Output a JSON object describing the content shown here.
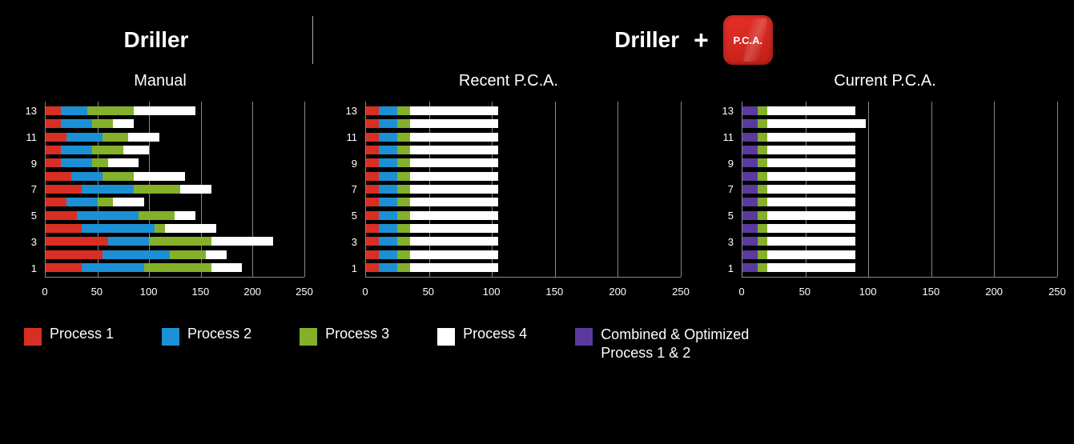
{
  "header": {
    "left_title": "Driller",
    "right_title": "Driller",
    "plus": "+",
    "badge": "P.C.A."
  },
  "legend": {
    "p1": "Process 1",
    "p2": "Process 2",
    "p3": "Process 3",
    "p4": "Process 4",
    "pc": "Combined & Optimized Process 1 & 2"
  },
  "colors": {
    "p1": "#d92e23",
    "p2": "#1c90d4",
    "p3": "#85b02a",
    "p4": "#ffffff",
    "pc": "#5a3a9e"
  },
  "chart_data": [
    {
      "id": "manual",
      "title": "Manual",
      "type": "bar",
      "orientation": "horizontal",
      "stacked": true,
      "xlim": [
        0,
        250
      ],
      "xticks": [
        0,
        50,
        100,
        150,
        200,
        250
      ],
      "yticks": [
        1,
        3,
        5,
        7,
        9,
        11,
        13
      ],
      "categories": [
        1,
        2,
        3,
        4,
        5,
        6,
        7,
        8,
        9,
        10,
        11,
        12,
        13
      ],
      "series": [
        {
          "name": "Process 1",
          "key": "p1",
          "values": [
            35,
            55,
            60,
            35,
            30,
            20,
            35,
            25,
            15,
            15,
            20,
            15,
            15
          ]
        },
        {
          "name": "Process 2",
          "key": "p2",
          "values": [
            60,
            65,
            40,
            70,
            60,
            30,
            50,
            30,
            30,
            30,
            35,
            30,
            25
          ]
        },
        {
          "name": "Process 3",
          "key": "p3",
          "values": [
            65,
            35,
            60,
            10,
            35,
            15,
            45,
            30,
            15,
            30,
            25,
            20,
            45
          ]
        },
        {
          "name": "Process 4",
          "key": "p4",
          "values": [
            30,
            20,
            60,
            50,
            20,
            30,
            30,
            50,
            30,
            25,
            30,
            20,
            60
          ]
        }
      ]
    },
    {
      "id": "recent",
      "title": "Recent P.C.A.",
      "type": "bar",
      "orientation": "horizontal",
      "stacked": true,
      "xlim": [
        0,
        250
      ],
      "xticks": [
        0,
        50,
        100,
        150,
        200,
        250
      ],
      "yticks": [
        1,
        3,
        5,
        7,
        9,
        11,
        13
      ],
      "categories": [
        1,
        2,
        3,
        4,
        5,
        6,
        7,
        8,
        9,
        10,
        11,
        12,
        13
      ],
      "series": [
        {
          "name": "Process 1",
          "key": "p1",
          "values": [
            10,
            10,
            10,
            10,
            10,
            10,
            10,
            10,
            10,
            10,
            10,
            10,
            10
          ]
        },
        {
          "name": "Process 2",
          "key": "p2",
          "values": [
            15,
            15,
            15,
            15,
            15,
            15,
            15,
            15,
            15,
            15,
            15,
            15,
            15
          ]
        },
        {
          "name": "Process 3",
          "key": "p3",
          "values": [
            10,
            10,
            10,
            10,
            10,
            10,
            10,
            10,
            10,
            10,
            10,
            10,
            10
          ]
        },
        {
          "name": "Process 4",
          "key": "p4",
          "values": [
            70,
            70,
            70,
            70,
            70,
            70,
            70,
            70,
            70,
            70,
            70,
            70,
            70
          ]
        }
      ]
    },
    {
      "id": "current",
      "title": "Current P.C.A.",
      "type": "bar",
      "orientation": "horizontal",
      "stacked": true,
      "xlim": [
        0,
        250
      ],
      "xticks": [
        0,
        50,
        100,
        150,
        200,
        250
      ],
      "yticks": [
        1,
        3,
        5,
        7,
        9,
        11,
        13
      ],
      "categories": [
        1,
        2,
        3,
        4,
        5,
        6,
        7,
        8,
        9,
        10,
        11,
        12,
        13
      ],
      "series": [
        {
          "name": "Combined & Optimized Process 1 & 2",
          "key": "pc",
          "values": [
            12,
            12,
            12,
            12,
            12,
            12,
            12,
            12,
            12,
            12,
            12,
            12,
            12
          ]
        },
        {
          "name": "Process 3",
          "key": "p3",
          "values": [
            8,
            8,
            8,
            8,
            8,
            8,
            8,
            8,
            8,
            8,
            8,
            8,
            8
          ]
        },
        {
          "name": "Process 4",
          "key": "p4",
          "values": [
            70,
            70,
            70,
            70,
            70,
            70,
            70,
            70,
            70,
            70,
            70,
            78,
            70
          ]
        }
      ]
    }
  ]
}
